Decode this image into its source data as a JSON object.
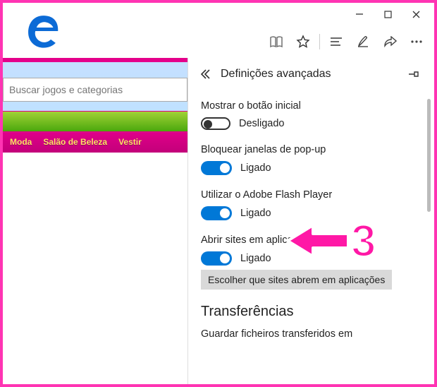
{
  "window_controls": {
    "minimize": "−",
    "maximize": "▢",
    "close": "✕"
  },
  "toolbar_icons": {
    "reading": "book-icon",
    "favorite": "star-icon",
    "hub": "lines-icon",
    "note": "pen-icon",
    "share": "share-icon",
    "more": "dots-icon"
  },
  "page": {
    "search_placeholder": "Buscar jogos e categorias",
    "nav": [
      "Moda",
      "Salão de Beleza",
      "Vestir"
    ]
  },
  "panel": {
    "title": "Definições avançadas",
    "settings": [
      {
        "label": "Mostrar o botão inicial",
        "state": "Desligado",
        "on": false
      },
      {
        "label": "Bloquear janelas de pop-up",
        "state": "Ligado",
        "on": true
      },
      {
        "label": "Utilizar o Adobe Flash Player",
        "state": "Ligado",
        "on": true
      },
      {
        "label": "Abrir sites em aplicações",
        "state": "Ligado",
        "on": true
      }
    ],
    "choose_sites_button": "Escolher que sites abrem em aplicações",
    "section_downloads": "Transferências",
    "downloads_sublabel": "Guardar ficheiros transferidos em"
  },
  "annotation": {
    "step_number": "3"
  },
  "colors": {
    "accent_pink": "#ff18a6",
    "toggle_on": "#0078d7"
  }
}
